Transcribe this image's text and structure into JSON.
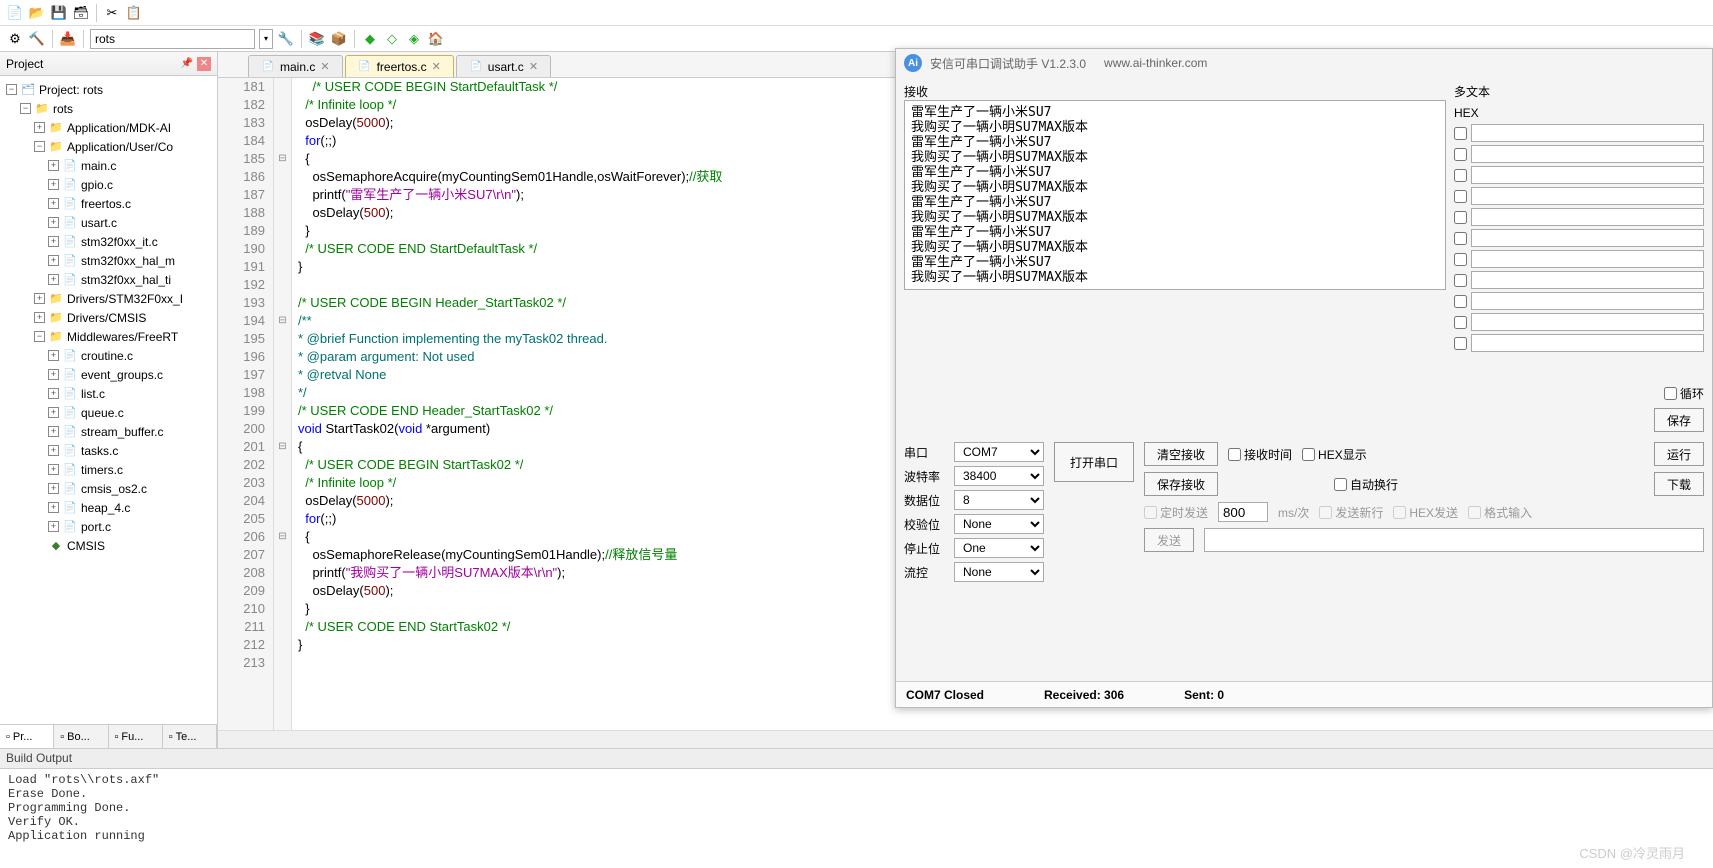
{
  "toolbar": {
    "target_combo": "rots"
  },
  "project": {
    "header": "Project",
    "root": "Project: rots",
    "target": "rots",
    "groups": [
      {
        "name": "Application/MDK-AI",
        "expanded": false,
        "files": []
      },
      {
        "name": "Application/User/Co",
        "expanded": true,
        "files": [
          "main.c",
          "gpio.c",
          "freertos.c",
          "usart.c",
          "stm32f0xx_it.c",
          "stm32f0xx_hal_m",
          "stm32f0xx_hal_ti"
        ]
      },
      {
        "name": "Drivers/STM32F0xx_I",
        "expanded": false,
        "files": []
      },
      {
        "name": "Drivers/CMSIS",
        "expanded": false,
        "files": []
      },
      {
        "name": "Middlewares/FreeRT",
        "expanded": true,
        "files": [
          "croutine.c",
          "event_groups.c",
          "list.c",
          "queue.c",
          "stream_buffer.c",
          "tasks.c",
          "timers.c",
          "cmsis_os2.c",
          "heap_4.c",
          "port.c"
        ]
      }
    ],
    "cmsis": "CMSIS",
    "tabs": [
      "Pr...",
      "Bo...",
      "Fu...",
      "Te..."
    ]
  },
  "editor": {
    "tabs": [
      {
        "label": "main.c",
        "active": false
      },
      {
        "label": "freertos.c",
        "active": true
      },
      {
        "label": "usart.c",
        "active": false
      }
    ],
    "code": [
      {
        "n": 181,
        "fold": "",
        "seg": [
          [
            "    ",
            ""
          ],
          [
            "/* USER CODE BEGIN StartDefaultTask */",
            "cgreen"
          ]
        ]
      },
      {
        "n": 182,
        "fold": "",
        "seg": [
          [
            "  ",
            ""
          ],
          [
            "/* Infinite loop */",
            "cgreen"
          ]
        ]
      },
      {
        "n": 183,
        "fold": "",
        "seg": [
          [
            "  osDelay(",
            ""
          ],
          [
            "5000",
            "cbrown"
          ],
          [
            ");",
            ""
          ]
        ]
      },
      {
        "n": 184,
        "fold": "",
        "seg": [
          [
            "  ",
            ""
          ],
          [
            "for",
            "cblue"
          ],
          [
            "(;;)",
            ""
          ]
        ]
      },
      {
        "n": 185,
        "fold": "⊟",
        "seg": [
          [
            "  {",
            ""
          ]
        ]
      },
      {
        "n": 186,
        "fold": "",
        "seg": [
          [
            "    osSemaphoreAcquire(myCountingSem01Handle,osWaitForever);",
            ""
          ],
          [
            "//获取",
            "cgreen"
          ]
        ]
      },
      {
        "n": 187,
        "fold": "",
        "seg": [
          [
            "    printf(",
            ""
          ],
          [
            "\"雷军生产了一辆小米SU7\\r\\n\"",
            "cmagenta"
          ],
          [
            ");",
            ""
          ]
        ]
      },
      {
        "n": 188,
        "fold": "",
        "seg": [
          [
            "    osDelay(",
            ""
          ],
          [
            "500",
            "cbrown"
          ],
          [
            ");",
            ""
          ]
        ]
      },
      {
        "n": 189,
        "fold": "",
        "seg": [
          [
            "  }",
            ""
          ]
        ]
      },
      {
        "n": 190,
        "fold": "",
        "seg": [
          [
            "  ",
            ""
          ],
          [
            "/* USER CODE END StartDefaultTask */",
            "cgreen"
          ]
        ]
      },
      {
        "n": 191,
        "fold": "",
        "seg": [
          [
            "}",
            ""
          ]
        ]
      },
      {
        "n": 192,
        "fold": "",
        "seg": [
          [
            "",
            ""
          ]
        ]
      },
      {
        "n": 193,
        "fold": "",
        "seg": [
          [
            "/* USER CODE BEGIN Header_StartTask02 */",
            "cgreen"
          ]
        ]
      },
      {
        "n": 194,
        "fold": "⊟",
        "seg": [
          [
            "/**",
            "cteal"
          ]
        ]
      },
      {
        "n": 195,
        "fold": "",
        "seg": [
          [
            "* @brief Function implementing the myTask02 thread.",
            "cteal"
          ]
        ]
      },
      {
        "n": 196,
        "fold": "",
        "seg": [
          [
            "* @param argument: Not used",
            "cteal"
          ]
        ]
      },
      {
        "n": 197,
        "fold": "",
        "seg": [
          [
            "* @retval None",
            "cteal"
          ]
        ]
      },
      {
        "n": 198,
        "fold": "",
        "seg": [
          [
            "*/",
            "cteal"
          ]
        ]
      },
      {
        "n": 199,
        "fold": "",
        "seg": [
          [
            "/* USER CODE END Header_StartTask02 */",
            "cgreen"
          ]
        ]
      },
      {
        "n": 200,
        "fold": "",
        "seg": [
          [
            "void",
            "cblue"
          ],
          [
            " StartTask02(",
            ""
          ],
          [
            "void",
            "cblue"
          ],
          [
            " *argument)",
            ""
          ]
        ]
      },
      {
        "n": 201,
        "fold": "⊟",
        "seg": [
          [
            "{",
            ""
          ]
        ]
      },
      {
        "n": 202,
        "fold": "",
        "seg": [
          [
            "  ",
            ""
          ],
          [
            "/* USER CODE BEGIN StartTask02 */",
            "cgreen"
          ]
        ]
      },
      {
        "n": 203,
        "fold": "",
        "seg": [
          [
            "  ",
            ""
          ],
          [
            "/* Infinite loop */",
            "cgreen"
          ]
        ]
      },
      {
        "n": 204,
        "fold": "",
        "seg": [
          [
            "  osDelay(",
            ""
          ],
          [
            "5000",
            "cbrown"
          ],
          [
            ");",
            ""
          ]
        ]
      },
      {
        "n": 205,
        "fold": "",
        "seg": [
          [
            "  ",
            ""
          ],
          [
            "for",
            "cblue"
          ],
          [
            "(;;)",
            ""
          ]
        ]
      },
      {
        "n": 206,
        "fold": "⊟",
        "seg": [
          [
            "  {",
            ""
          ]
        ]
      },
      {
        "n": 207,
        "fold": "",
        "seg": [
          [
            "    osSemaphoreRelease(myCountingSem01Handle);",
            ""
          ],
          [
            "//释放信号量",
            "cgreen"
          ]
        ]
      },
      {
        "n": 208,
        "fold": "",
        "seg": [
          [
            "    printf(",
            ""
          ],
          [
            "\"我购买了一辆小明SU7MAX版本\\r\\n\"",
            "cmagenta"
          ],
          [
            ");",
            ""
          ]
        ]
      },
      {
        "n": 209,
        "fold": "",
        "seg": [
          [
            "    osDelay(",
            ""
          ],
          [
            "500",
            "cbrown"
          ],
          [
            ");",
            ""
          ]
        ]
      },
      {
        "n": 210,
        "fold": "",
        "seg": [
          [
            "  }",
            ""
          ]
        ]
      },
      {
        "n": 211,
        "fold": "",
        "seg": [
          [
            "  ",
            ""
          ],
          [
            "/* USER CODE END StartTask02 */",
            "cgreen"
          ]
        ]
      },
      {
        "n": 212,
        "fold": "",
        "seg": [
          [
            "}",
            ""
          ]
        ]
      },
      {
        "n": 213,
        "fold": "",
        "seg": [
          [
            "",
            ""
          ]
        ]
      }
    ]
  },
  "build": {
    "header": "Build Output",
    "text": "Load \"rots\\\\rots.axf\"\nErase Done.\nProgramming Done.\nVerify OK.\nApplication running"
  },
  "serial": {
    "title": "安信可串口调试助手 V1.2.3.0",
    "url": "www.ai-thinker.com",
    "rx_label": "接收",
    "multi_label": "多文本",
    "hex_label": "HEX",
    "rx_text": "雷军生产了一辆小米SU7\n我购买了一辆小明SU7MAX版本\n雷军生产了一辆小米SU7\n我购买了一辆小明SU7MAX版本\n雷军生产了一辆小米SU7\n我购买了一辆小明SU7MAX版本\n雷军生产了一辆小米SU7\n我购买了一辆小明SU7MAX版本\n雷军生产了一辆小米SU7\n我购买了一辆小明SU7MAX版本\n雷军生产了一辆小米SU7\n我购买了一辆小明SU7MAX版本",
    "port_label": "串口",
    "port": "COM7",
    "baud_label": "波特率",
    "baud": "38400",
    "databits_label": "数据位",
    "databits": "8",
    "parity_label": "校验位",
    "parity": "None",
    "stopbits_label": "停止位",
    "stopbits": "One",
    "flow_label": "流控",
    "flow": "None",
    "open_btn": "打开串口",
    "clear_rx_btn": "清空接收",
    "save_rx_btn": "保存接收",
    "rx_time_chk": "接收时间",
    "hex_show_chk": "HEX显示",
    "auto_wrap_chk": "自动换行",
    "run_btn": "运行",
    "download_btn": "下载",
    "timed_send_chk": "定时发送",
    "interval": "800",
    "interval_unit": "ms/次",
    "newline_chk": "发送新行",
    "hex_send_chk": "HEX发送",
    "fmt_input_chk": "格式输入",
    "send_btn": "发送",
    "loop_chk": "循环",
    "save_btn": "保存",
    "status_port": "COM7 Closed",
    "status_rx": "Received: 306",
    "status_tx": "Sent: 0"
  },
  "watermark": "CSDN @冷灵雨月"
}
